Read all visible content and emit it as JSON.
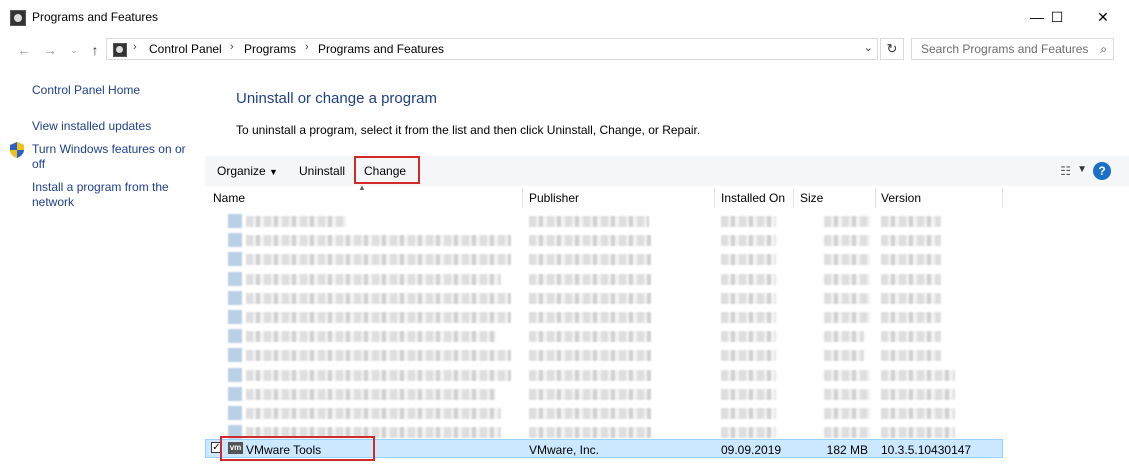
{
  "window": {
    "title": "Programs and Features",
    "minimize": "—",
    "maximize": "☐",
    "close": "✕"
  },
  "address": {
    "crumbs": [
      "Control Panel",
      "Programs",
      "Programs and Features"
    ],
    "separator": "›",
    "search_placeholder": "Search Programs and Features"
  },
  "sidebar": {
    "items": [
      {
        "label": "Control Panel Home"
      },
      {
        "label": "View installed updates"
      },
      {
        "label": "Turn Windows features on or off"
      },
      {
        "label": "Install a program from the network"
      }
    ]
  },
  "main": {
    "heading": "Uninstall or change a program",
    "description": "To uninstall a program, select it from the list and then click Uninstall, Change, or Repair."
  },
  "toolbar": {
    "organize": "Organize",
    "uninstall": "Uninstall",
    "change": "Change",
    "help": "?"
  },
  "table": {
    "columns": [
      "Name",
      "Publisher",
      "Installed On",
      "Size",
      "Version"
    ],
    "selected_row": {
      "name": "VMware Tools",
      "publisher": "VMware, Inc.",
      "installed_on": "09.09.2019",
      "size": "182 MB",
      "version": "10.3.5.10430147",
      "icon_text": "vm",
      "checked": "✓"
    }
  },
  "colors": {
    "link": "#1e3f8a",
    "selection": "#cce8ff",
    "highlight_box": "#d12a2a",
    "help": "#1a6fc9"
  }
}
